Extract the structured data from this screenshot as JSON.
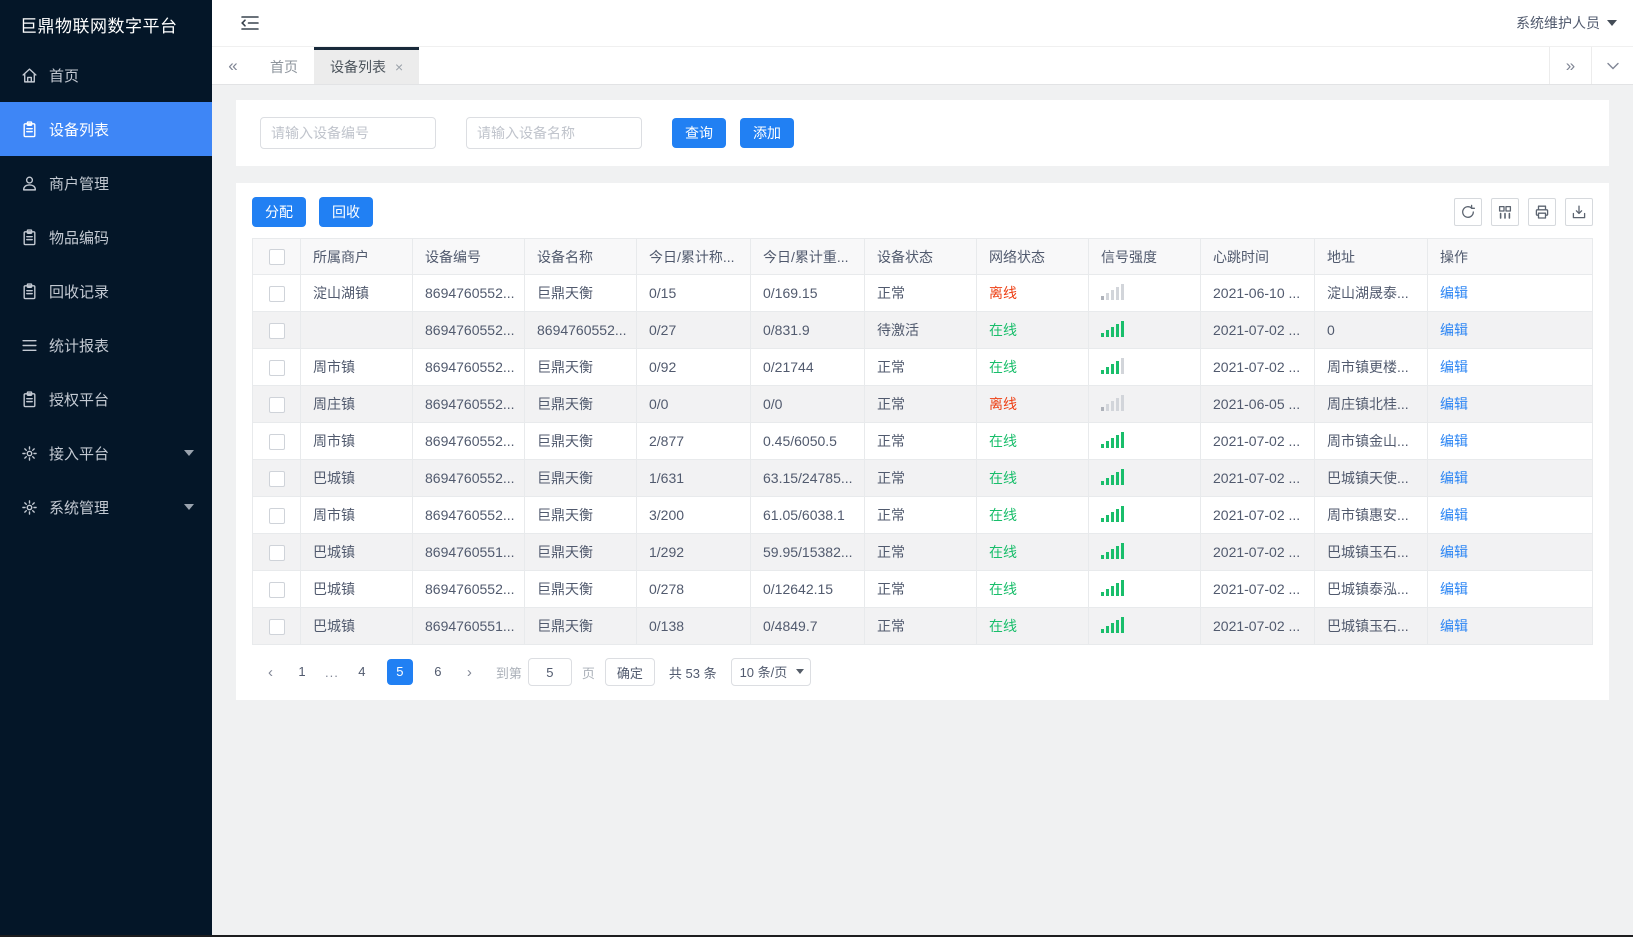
{
  "app": {
    "title": "巨鼎物联网数字平台",
    "user": "系统维护人员"
  },
  "colors": {
    "primary": "#2180f3",
    "sidebar_bg": "#041628",
    "sidebar_active": "#3e86f6",
    "online_green": "#19be6b",
    "offline_red": "#ed3f14",
    "link_blue": "#2b85f4"
  },
  "sidebar": {
    "items": [
      {
        "label": "首页",
        "icon": "home-icon",
        "active": false,
        "expandable": false
      },
      {
        "label": "设备列表",
        "icon": "device-list-icon",
        "active": true,
        "expandable": false
      },
      {
        "label": "商户管理",
        "icon": "user-icon",
        "active": false,
        "expandable": false
      },
      {
        "label": "物品编码",
        "icon": "clipboard-icon",
        "active": false,
        "expandable": false
      },
      {
        "label": "回收记录",
        "icon": "clipboard-icon",
        "active": false,
        "expandable": false
      },
      {
        "label": "统计报表",
        "icon": "list-icon",
        "active": false,
        "expandable": false
      },
      {
        "label": "授权平台",
        "icon": "clipboard-icon",
        "active": false,
        "expandable": false
      },
      {
        "label": "接入平台",
        "icon": "gear-icon",
        "active": false,
        "expandable": true
      },
      {
        "label": "系统管理",
        "icon": "gear-icon",
        "active": false,
        "expandable": true
      }
    ]
  },
  "tabs": {
    "collapse_left": "«",
    "expand_right": "»",
    "close_glyph": "×",
    "items": [
      {
        "label": "首页",
        "active": false,
        "closable": false
      },
      {
        "label": "设备列表",
        "active": true,
        "closable": true
      }
    ]
  },
  "search": {
    "device_no_placeholder": "请输入设备编号",
    "device_name_placeholder": "请输入设备名称",
    "query_label": "查询",
    "add_label": "添加"
  },
  "toolbar": {
    "assign_label": "分配",
    "recycle_label": "回收",
    "icons": [
      "refresh-icon",
      "columns-icon",
      "printer-icon",
      "export-icon"
    ]
  },
  "table": {
    "columns": [
      "所属商户",
      "设备编号",
      "设备名称",
      "今日/累计称...",
      "今日/累计重...",
      "设备状态",
      "网络状态",
      "信号强度",
      "心跳时间",
      "地址",
      "操作"
    ],
    "rows": [
      {
        "merchant": "淀山湖镇",
        "device_no": "8694760552...",
        "device_name": "巨鼎天衡",
        "today_count": "0/15",
        "today_weight": "0/169.15",
        "device_status": "正常",
        "network_status": "离线",
        "online": false,
        "signal_level": 1,
        "heartbeat": "2021-06-10 ...",
        "address": "淀山湖晟泰...",
        "action": "编辑"
      },
      {
        "merchant": "",
        "device_no": "8694760552...",
        "device_name": "8694760552...",
        "today_count": "0/27",
        "today_weight": "0/831.9",
        "device_status": "待激活",
        "network_status": "在线",
        "online": true,
        "signal_level": 5,
        "heartbeat": "2021-07-02 ...",
        "address": "0",
        "action": "编辑"
      },
      {
        "merchant": "周市镇",
        "device_no": "8694760552...",
        "device_name": "巨鼎天衡",
        "today_count": "0/92",
        "today_weight": "0/21744",
        "device_status": "正常",
        "network_status": "在线",
        "online": true,
        "signal_level": 4,
        "heartbeat": "2021-07-02 ...",
        "address": "周市镇更楼...",
        "action": "编辑"
      },
      {
        "merchant": "周庄镇",
        "device_no": "8694760552...",
        "device_name": "巨鼎天衡",
        "today_count": "0/0",
        "today_weight": "0/0",
        "device_status": "正常",
        "network_status": "离线",
        "online": false,
        "signal_level": 1,
        "heartbeat": "2021-06-05 ...",
        "address": "周庄镇北桂...",
        "action": "编辑"
      },
      {
        "merchant": "周市镇",
        "device_no": "8694760552...",
        "device_name": "巨鼎天衡",
        "today_count": "2/877",
        "today_weight": "0.45/6050.5",
        "device_status": "正常",
        "network_status": "在线",
        "online": true,
        "signal_level": 5,
        "heartbeat": "2021-07-02 ...",
        "address": "周市镇金山...",
        "action": "编辑"
      },
      {
        "merchant": "巴城镇",
        "device_no": "8694760552...",
        "device_name": "巨鼎天衡",
        "today_count": "1/631",
        "today_weight": "63.15/24785...",
        "device_status": "正常",
        "network_status": "在线",
        "online": true,
        "signal_level": 5,
        "heartbeat": "2021-07-02 ...",
        "address": "巴城镇天使...",
        "action": "编辑"
      },
      {
        "merchant": "周市镇",
        "device_no": "8694760552...",
        "device_name": "巨鼎天衡",
        "today_count": "3/200",
        "today_weight": "61.05/6038.1",
        "device_status": "正常",
        "network_status": "在线",
        "online": true,
        "signal_level": 5,
        "heartbeat": "2021-07-02 ...",
        "address": "周市镇惠安...",
        "action": "编辑"
      },
      {
        "merchant": "巴城镇",
        "device_no": "8694760551...",
        "device_name": "巨鼎天衡",
        "today_count": "1/292",
        "today_weight": "59.95/15382...",
        "device_status": "正常",
        "network_status": "在线",
        "online": true,
        "signal_level": 5,
        "heartbeat": "2021-07-02 ...",
        "address": "巴城镇玉石...",
        "action": "编辑"
      },
      {
        "merchant": "巴城镇",
        "device_no": "8694760552...",
        "device_name": "巨鼎天衡",
        "today_count": "0/278",
        "today_weight": "0/12642.15",
        "device_status": "正常",
        "network_status": "在线",
        "online": true,
        "signal_level": 5,
        "heartbeat": "2021-07-02 ...",
        "address": "巴城镇泰泓...",
        "action": "编辑"
      },
      {
        "merchant": "巴城镇",
        "device_no": "8694760551...",
        "device_name": "巨鼎天衡",
        "today_count": "0/138",
        "today_weight": "0/4849.7",
        "device_status": "正常",
        "network_status": "在线",
        "online": true,
        "signal_level": 5,
        "heartbeat": "2021-07-02 ...",
        "address": "巴城镇玉石...",
        "action": "编辑"
      }
    ]
  },
  "pagination": {
    "prev": "‹",
    "next": "›",
    "pages": [
      {
        "label": "1",
        "active": false
      },
      {
        "label": "...",
        "ellipsis": true
      },
      {
        "label": "4",
        "active": false
      },
      {
        "label": "5",
        "active": true
      },
      {
        "label": "6",
        "active": false
      }
    ],
    "goto_label": "到第",
    "goto_value": "5",
    "page_unit": "页",
    "confirm_label": "确定",
    "total_label": "共 53 条",
    "page_size": "10 条/页",
    "page_size_options": [
      "10 条/页"
    ]
  }
}
